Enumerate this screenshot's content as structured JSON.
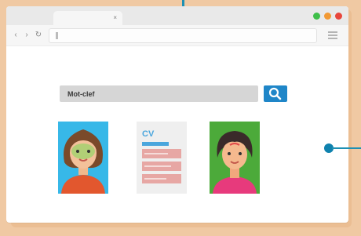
{
  "colors": {
    "background": "#f0c9a3",
    "accent": "#1f86c8",
    "callout": "#1d90b4",
    "window_dots": [
      "#3fbf4a",
      "#f29a35",
      "#e8463c"
    ]
  },
  "browser": {
    "tab": {
      "label": "",
      "close_glyph": "×"
    },
    "nav": {
      "back": "‹",
      "forward": "›",
      "reload": "↻"
    },
    "address_value": ""
  },
  "search": {
    "value": "Mot-clef",
    "icon": "search-icon"
  },
  "results": [
    {
      "type": "avatar",
      "icon": "woman-brown-hair-avatar",
      "bg": "#37b8e8"
    },
    {
      "type": "cv",
      "label": "CV",
      "icon": "cv-document-icon"
    },
    {
      "type": "avatar",
      "icon": "woman-dark-hair-avatar",
      "bg": "#4caa3a"
    }
  ]
}
